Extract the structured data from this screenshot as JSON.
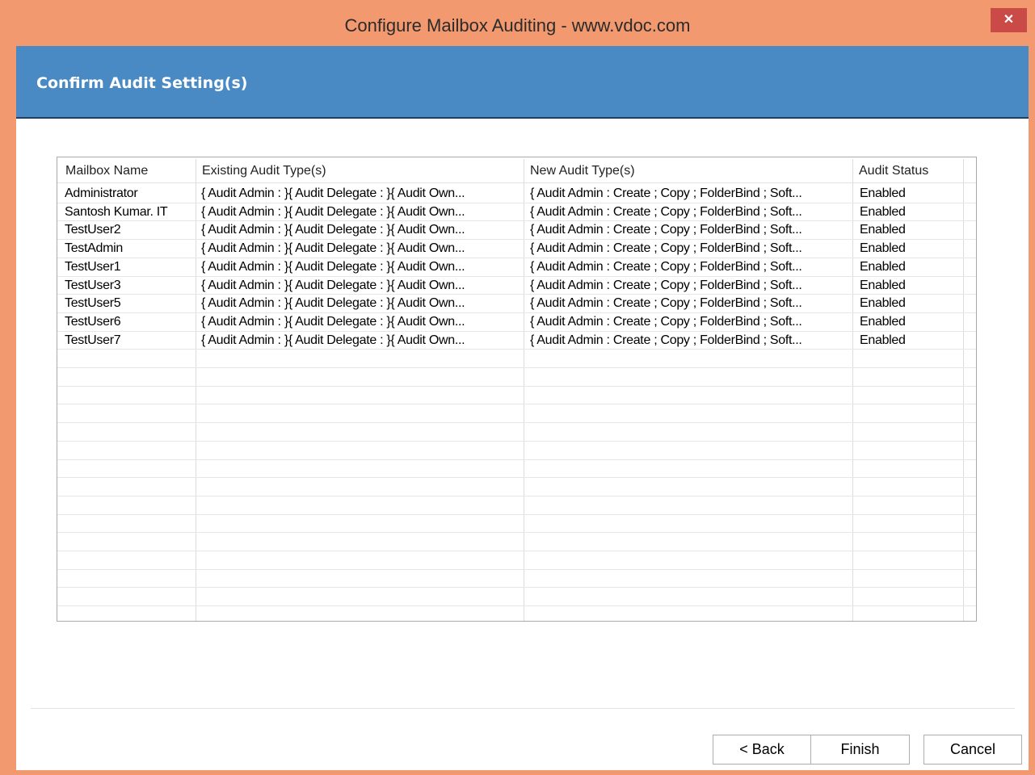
{
  "window": {
    "title": "Configure Mailbox Auditing - www.vdoc.com",
    "close_glyph": "✕",
    "frame_color": "#f3996f",
    "close_color": "#c94a47"
  },
  "header": {
    "title": "Confirm Audit Setting(s)",
    "band_color": "#4a8ac4"
  },
  "grid": {
    "columns": [
      "Mailbox Name",
      "Existing Audit Type(s)",
      "New Audit Type(s)",
      "Audit Status"
    ],
    "rows": [
      {
        "mailbox": "Administrator",
        "existing": "{ Audit Admin :  }{ Audit Delegate :  }{ Audit Own...",
        "new": "{ Audit Admin : Create ; Copy ; FolderBind ; Soft...",
        "status": "Enabled"
      },
      {
        "mailbox": "Santosh Kumar. IT",
        "existing": "{ Audit Admin :  }{ Audit Delegate :  }{ Audit Own...",
        "new": "{ Audit Admin : Create ; Copy ; FolderBind ; Soft...",
        "status": "Enabled"
      },
      {
        "mailbox": "TestUser2",
        "existing": "{ Audit Admin :  }{ Audit Delegate :  }{ Audit Own...",
        "new": "{ Audit Admin : Create ; Copy ; FolderBind ; Soft...",
        "status": "Enabled"
      },
      {
        "mailbox": "TestAdmin",
        "existing": "{ Audit Admin :  }{ Audit Delegate :  }{ Audit Own...",
        "new": "{ Audit Admin : Create ; Copy ; FolderBind ; Soft...",
        "status": "Enabled"
      },
      {
        "mailbox": "TestUser1",
        "existing": "{ Audit Admin :  }{ Audit Delegate :  }{ Audit Own...",
        "new": "{ Audit Admin : Create ; Copy ; FolderBind ; Soft...",
        "status": "Enabled"
      },
      {
        "mailbox": "TestUser3",
        "existing": "{ Audit Admin :  }{ Audit Delegate :  }{ Audit Own...",
        "new": "{ Audit Admin : Create ; Copy ; FolderBind ; Soft...",
        "status": "Enabled"
      },
      {
        "mailbox": "TestUser5",
        "existing": "{ Audit Admin :  }{ Audit Delegate :  }{ Audit Own...",
        "new": "{ Audit Admin : Create ; Copy ; FolderBind ; Soft...",
        "status": "Enabled"
      },
      {
        "mailbox": "TestUser6",
        "existing": "{ Audit Admin :  }{ Audit Delegate :  }{ Audit Own...",
        "new": "{ Audit Admin : Create ; Copy ; FolderBind ; Soft...",
        "status": "Enabled"
      },
      {
        "mailbox": "TestUser7",
        "existing": "{ Audit Admin :  }{ Audit Delegate :  }{ Audit Own...",
        "new": "{ Audit Admin : Create ; Copy ; FolderBind ; Soft...",
        "status": "Enabled"
      }
    ]
  },
  "buttons": {
    "back": "< Back",
    "finish": "Finish",
    "cancel": "Cancel"
  }
}
